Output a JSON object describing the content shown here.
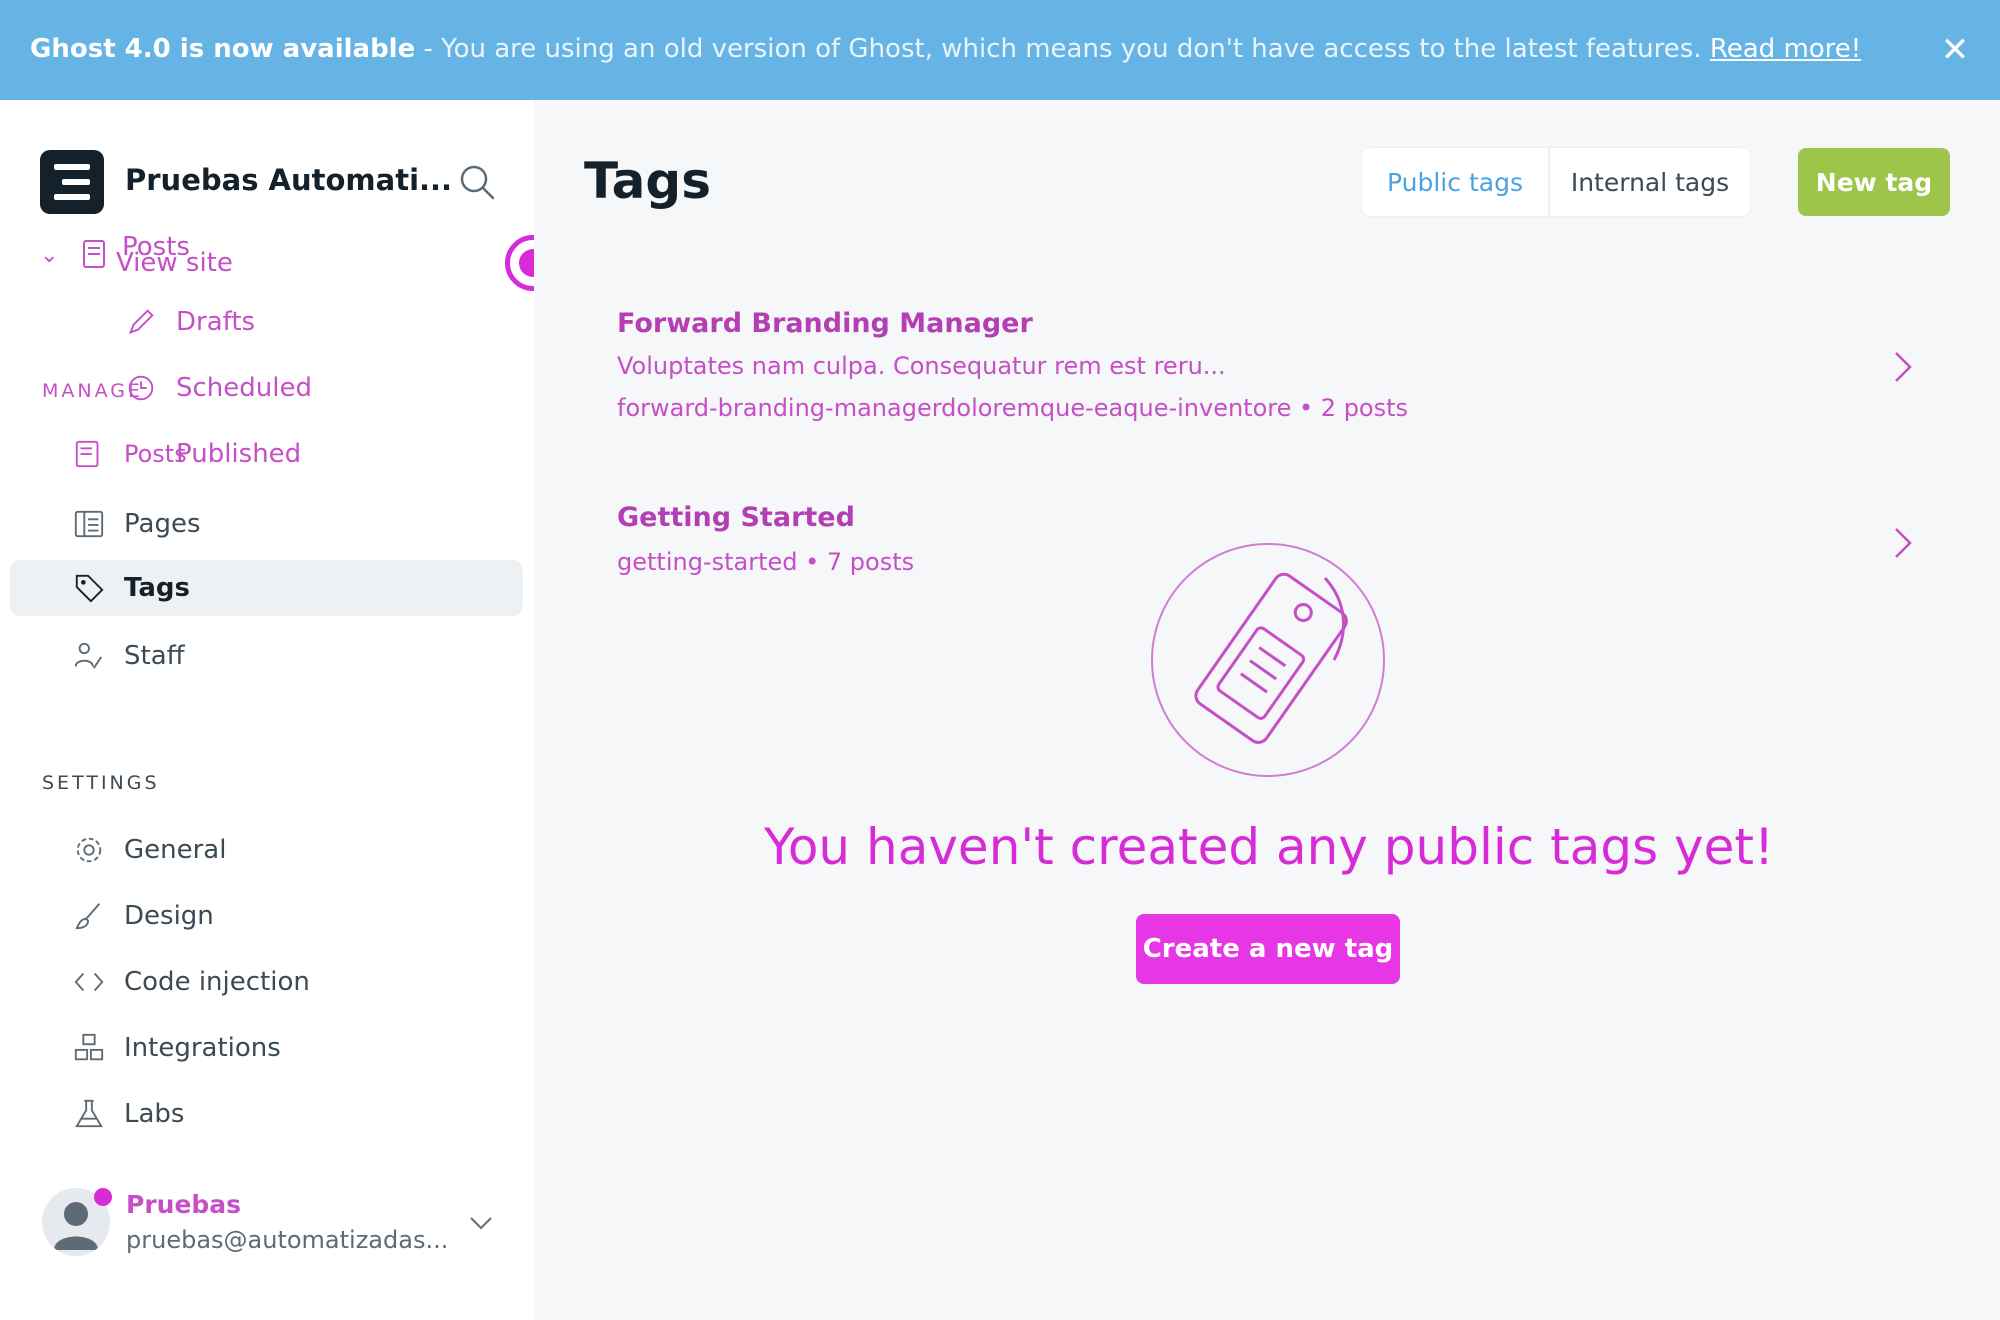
{
  "banner": {
    "title": "Ghost 4.0 is now available",
    "message": " - You are using an old version of Ghost, which means you don't have access to the latest features. ",
    "link": "Read more!",
    "close_icon": "close-icon"
  },
  "brand": {
    "name": "Pruebas Automati..."
  },
  "sidebar": {
    "posts": {
      "label": "Posts",
      "overlay_label": "View site"
    },
    "posts_sub": [
      {
        "label": "Drafts",
        "icon": "pencil-icon"
      },
      {
        "label": "Scheduled",
        "icon": "clock-icon"
      },
      {
        "label": "Published",
        "icon": "document-icon"
      }
    ],
    "manage_label": "MANAGE",
    "posts_overlay": "Posts",
    "items": [
      {
        "label": "Pages",
        "icon": "pages-icon"
      },
      {
        "label": "Tags",
        "icon": "tag-icon"
      },
      {
        "label": "Staff",
        "icon": "staff-icon"
      }
    ],
    "settings_label": "SETTINGS",
    "settings": [
      {
        "label": "General",
        "icon": "gear-icon"
      },
      {
        "label": "Design",
        "icon": "brush-icon"
      },
      {
        "label": "Code injection",
        "icon": "code-icon"
      },
      {
        "label": "Integrations",
        "icon": "integrations-icon"
      },
      {
        "label": "Labs",
        "icon": "flask-icon"
      }
    ],
    "user": {
      "name": "Pruebas",
      "email": "pruebas@automatizadas..."
    }
  },
  "main": {
    "title": "Tags",
    "tabs": {
      "public": "Public tags",
      "internal": "Internal tags"
    },
    "new_tag": "New tag",
    "tags": [
      {
        "name": "Forward Branding Manager",
        "description": "Voluptates nam culpa. Consequatur rem est reru...",
        "meta": "forward-branding-managerdoloremque-eaque-inventore • 2 posts"
      },
      {
        "name": "Getting Started",
        "meta": "getting-started • 7 posts"
      }
    ],
    "empty_text": "You haven't created any public tags yet!",
    "create_button": "Create a new tag"
  },
  "colors": {
    "banner": "#66b4e6",
    "accent_green": "#9cc54a",
    "accent_magenta": "#e636e6",
    "link_blue": "#4aa3e0"
  }
}
